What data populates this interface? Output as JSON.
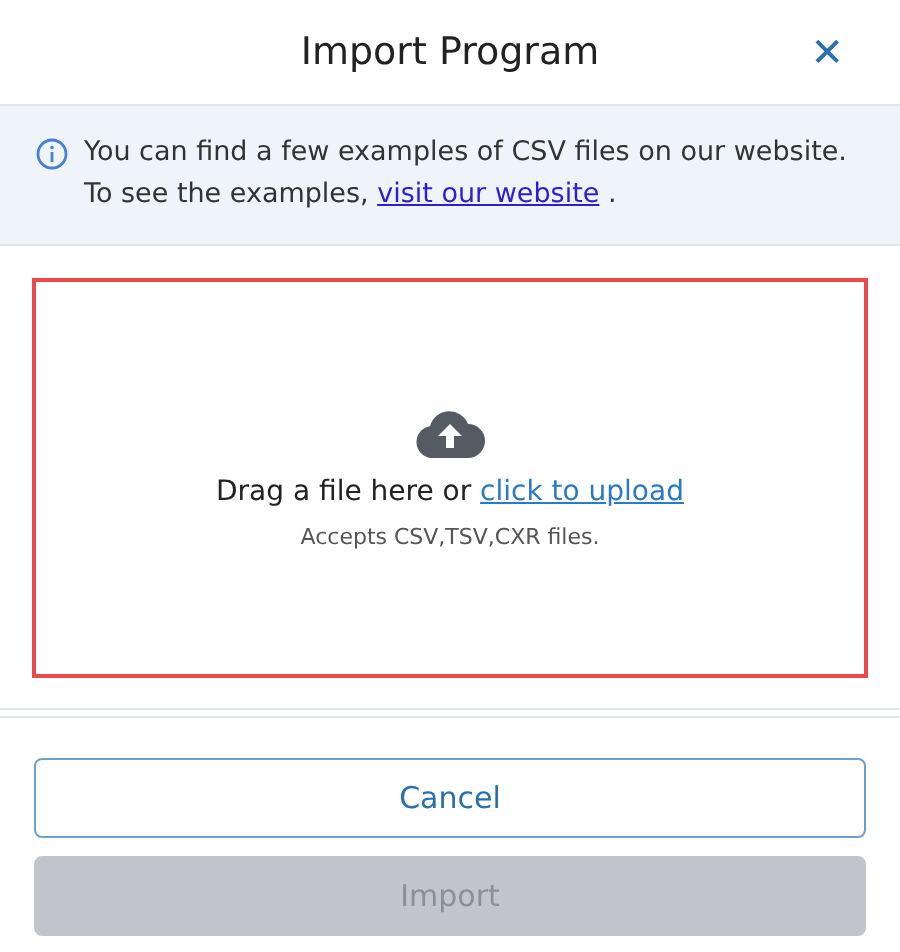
{
  "dialog": {
    "title": "Import Program",
    "close_label": "✕"
  },
  "info": {
    "text": "You can find a few examples of CSV files on our website. To see the examples, ",
    "link": "visit our website",
    "text_after": " ."
  },
  "dropzone": {
    "text": "Drag a file here or ",
    "link": "click to upload",
    "hint": "Accepts CSV,TSV,CXR files."
  },
  "buttons": [
    {
      "label": "Cancel",
      "kind": "secondary",
      "disabled": false
    },
    {
      "label": "Import",
      "kind": "primary",
      "disabled": true
    }
  ]
}
